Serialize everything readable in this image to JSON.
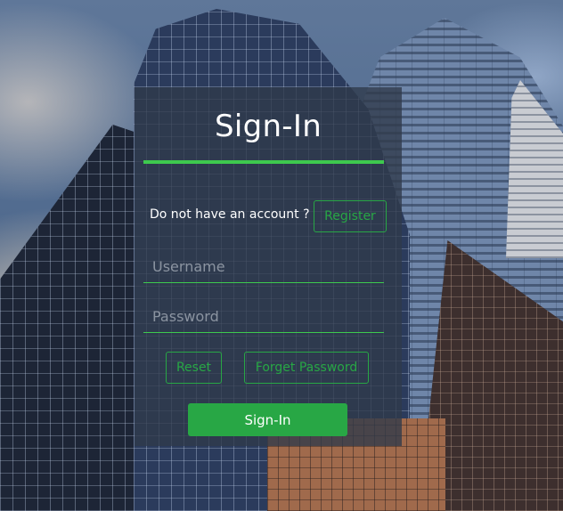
{
  "form": {
    "title": "Sign-In",
    "account_prompt": "Do not have an account ?",
    "register_label": "Register",
    "username_placeholder": "Username",
    "username_value": "",
    "password_placeholder": "Password",
    "password_value": "",
    "reset_label": "Reset",
    "forget_label": "Forget Password",
    "submit_label": "Sign-In"
  },
  "colors": {
    "accent": "#28a745",
    "panel": "#303a4a",
    "text": "#ffffff"
  },
  "background": {
    "description_icon": "city-skyscrapers-image"
  }
}
